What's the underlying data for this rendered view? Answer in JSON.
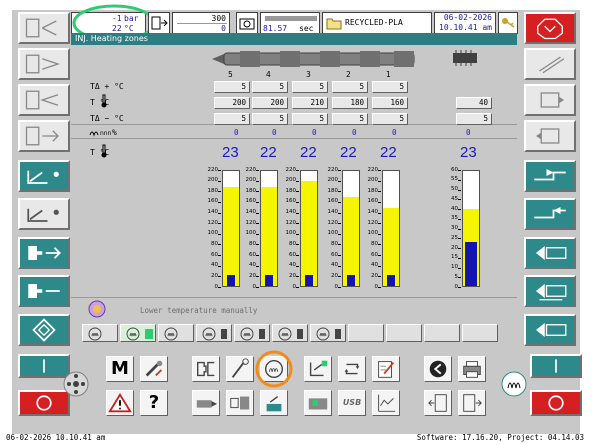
{
  "header": {
    "pressure_value": "-1",
    "pressure_unit": "bar",
    "oil_temp_value": "22",
    "oil_temp_unit": "°C",
    "counter_top": "300",
    "counter_bottom": "0",
    "cycle_time": "81.57",
    "cycle_unit": "sec",
    "folder_name": "RECYCLED-PLA",
    "date": "06-02-2026",
    "time": "10.10.41 am"
  },
  "title": "INJ. Heating zones",
  "zones": {
    "numbers": [
      "5",
      "4",
      "3",
      "2",
      "1"
    ],
    "plus_tol_label": "TΔ + °C",
    "setpoint_label": "T    °C",
    "minus_tol_label": "TΔ − °C",
    "output_label": "%",
    "actual_label": "T    °C",
    "plus_tol": [
      "5",
      "5",
      "5",
      "5",
      "5"
    ],
    "setpoint": [
      "200",
      "200",
      "210",
      "180",
      "160"
    ],
    "minus_tol": [
      "5",
      "5",
      "5",
      "5",
      "5"
    ],
    "output": [
      "0",
      "0",
      "0",
      "0",
      "0"
    ],
    "actual": [
      "23",
      "22",
      "22",
      "22",
      "22"
    ],
    "nozzle_setpoint": "40",
    "nozzle_minus": "5",
    "nozzle_output": "0",
    "nozzle_actual": "23"
  },
  "gauges": {
    "big_scale": [
      "220",
      "200",
      "180",
      "160",
      "140",
      "120",
      "100",
      "80",
      "60",
      "40",
      "20",
      "0"
    ],
    "small_scale": [
      "60",
      "55",
      "50",
      "45",
      "40",
      "35",
      "30",
      "25",
      "20",
      "15",
      "10",
      "5",
      "0"
    ],
    "zone_fill_fraction": [
      0.86,
      0.86,
      0.91,
      0.77,
      0.68
    ],
    "zone_actual_fraction": [
      0.1,
      0.1,
      0.1,
      0.1,
      0.1
    ],
    "nozzle_fill_fraction": 0.67,
    "nozzle_actual_fraction": 0.38
  },
  "status_message": "Lower temperature manually",
  "footer": {
    "left": "06-02-2026 10.10.41 am",
    "right": "Software: 17.16.20, Project: 04.14.03"
  },
  "toolbar": {
    "m_label": "M",
    "help_label": "?",
    "usb_label": "USB"
  },
  "colors": {
    "teal": "#2e8a8a",
    "red": "#d42020",
    "bar_yellow": "#f5f500",
    "bar_blue": "#1414b4",
    "highlight_green": "#2ecc71",
    "highlight_orange": "#f08c1e"
  }
}
